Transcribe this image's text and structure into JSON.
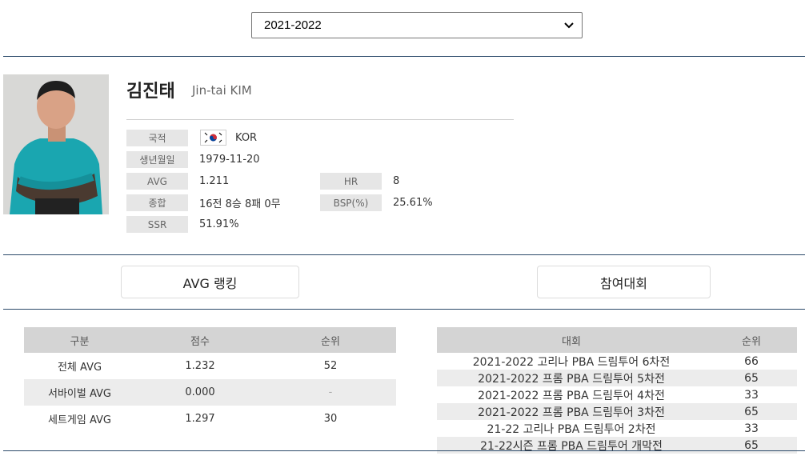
{
  "season_select": {
    "value": "2021-2022"
  },
  "player": {
    "name_ko": "김진태",
    "name_en": "Jin-tai KIM"
  },
  "info": {
    "nationality_label": "국적",
    "nationality_value": "KOR",
    "birth_label": "생년월일",
    "birth_value": "1979-11-20",
    "avg_label": "AVG",
    "avg_value": "1.211",
    "hr_label": "HR",
    "hr_value": "8",
    "record_label": "종합",
    "record_value": "16전 8승 8패 0무",
    "bsp_label": "BSP(%)",
    "bsp_value": "25.61%",
    "ssr_label": "SSR",
    "ssr_value": "51.91%"
  },
  "tabs": {
    "avg_ranking": "AVG 랭킹",
    "competitions": "참여대회"
  },
  "avg_table": {
    "headers": [
      "구분",
      "점수",
      "순위"
    ],
    "rows": [
      [
        "전체 AVG",
        "1.232",
        "52"
      ],
      [
        "서바이벌 AVG",
        "0.000",
        "-"
      ],
      [
        "세트게임 AVG",
        "1.297",
        "30"
      ]
    ]
  },
  "comp_table": {
    "headers": [
      "대회",
      "순위"
    ],
    "rows": [
      [
        "2021-2022 고리나 PBA 드림투어 6차전",
        "66"
      ],
      [
        "2021-2022 프롬 PBA 드림투어 5차전",
        "65"
      ],
      [
        "2021-2022 프롬 PBA 드림투어 4차전",
        "33"
      ],
      [
        "2021-2022 프롬 PBA 드림투어 3차전",
        "65"
      ],
      [
        "21-22 고리나 PBA 드림투어 2차전",
        "33"
      ],
      [
        "21-22시즌 프롬 PBA 드림투어 개막전",
        "65"
      ]
    ]
  },
  "colors": {
    "divider": "#2c4a6a",
    "header_bg": "#d4d4d4",
    "row_alt": "#ececec",
    "label_bg": "#e6e6e6"
  },
  "icons": {
    "flag": "korea-flag-icon",
    "dropdown": "chevron-down-icon"
  }
}
